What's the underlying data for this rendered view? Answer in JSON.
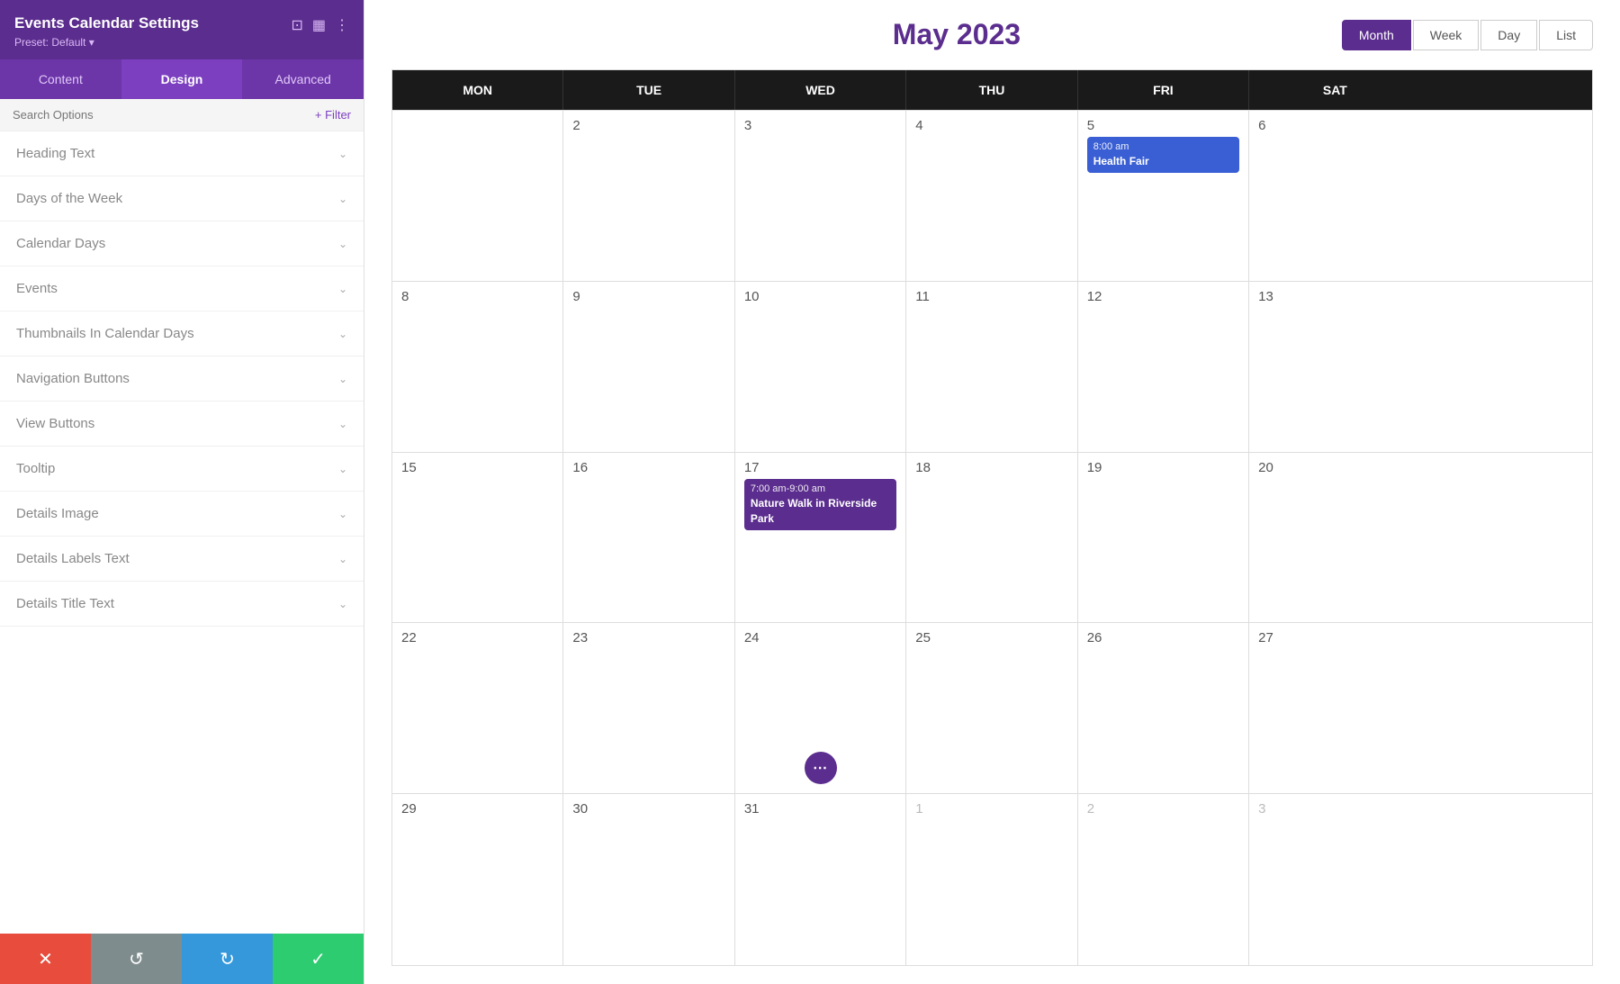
{
  "sidebar": {
    "title": "Events Calendar Settings",
    "preset": "Preset: Default ▾",
    "icons": {
      "minimize": "⊡",
      "layout": "▦",
      "more": "⋮"
    },
    "tabs": [
      {
        "id": "content",
        "label": "Content",
        "active": false
      },
      {
        "id": "design",
        "label": "Design",
        "active": true
      },
      {
        "id": "advanced",
        "label": "Advanced",
        "active": false
      }
    ],
    "search": {
      "placeholder": "Search Options",
      "filter_label": "+ Filter"
    },
    "items": [
      {
        "id": "heading-text",
        "label": "Heading Text"
      },
      {
        "id": "days-of-week",
        "label": "Days of the Week"
      },
      {
        "id": "calendar-days",
        "label": "Calendar Days"
      },
      {
        "id": "events",
        "label": "Events"
      },
      {
        "id": "thumbnails",
        "label": "Thumbnails In Calendar Days"
      },
      {
        "id": "navigation-buttons",
        "label": "Navigation Buttons"
      },
      {
        "id": "view-buttons",
        "label": "View Buttons"
      },
      {
        "id": "tooltip",
        "label": "Tooltip"
      },
      {
        "id": "details-image",
        "label": "Details Image"
      },
      {
        "id": "details-labels-text",
        "label": "Details Labels Text"
      },
      {
        "id": "details-title-text",
        "label": "Details Title Text"
      }
    ],
    "toolbar": {
      "cancel": "✕",
      "undo": "↺",
      "redo": "↻",
      "save": "✓"
    }
  },
  "calendar": {
    "title": "May 2023",
    "view_buttons": [
      {
        "id": "month",
        "label": "Month",
        "active": true
      },
      {
        "id": "week",
        "label": "Week",
        "active": false
      },
      {
        "id": "day",
        "label": "Day",
        "active": false
      },
      {
        "id": "list",
        "label": "List",
        "active": false
      }
    ],
    "day_headers": [
      "MON",
      "TUE",
      "WED",
      "THU",
      "FRI",
      "SAT"
    ],
    "rows": [
      {
        "cells": [
          {
            "date": "",
            "muted": false,
            "events": []
          },
          {
            "date": "2",
            "muted": false,
            "events": []
          },
          {
            "date": "3",
            "muted": false,
            "events": []
          },
          {
            "date": "4",
            "muted": false,
            "events": []
          },
          {
            "date": "5",
            "muted": false,
            "events": [
              {
                "time": "8:00 am",
                "title": "Health Fair",
                "color": "blue"
              }
            ]
          },
          {
            "date": "6",
            "muted": false,
            "events": []
          }
        ]
      },
      {
        "cells": [
          {
            "date": "8",
            "muted": false,
            "events": []
          },
          {
            "date": "9",
            "muted": false,
            "events": []
          },
          {
            "date": "10",
            "muted": false,
            "events": []
          },
          {
            "date": "11",
            "muted": false,
            "events": []
          },
          {
            "date": "12",
            "muted": false,
            "events": []
          },
          {
            "date": "13",
            "muted": false,
            "events": []
          }
        ]
      },
      {
        "cells": [
          {
            "date": "15",
            "muted": false,
            "events": []
          },
          {
            "date": "16",
            "muted": false,
            "events": []
          },
          {
            "date": "17",
            "muted": false,
            "events": [
              {
                "time": "7:00 am-9:00 am",
                "title": "Nature Walk in Riverside Park",
                "color": "purple"
              }
            ]
          },
          {
            "date": "18",
            "muted": false,
            "events": []
          },
          {
            "date": "19",
            "muted": false,
            "events": []
          },
          {
            "date": "20",
            "muted": false,
            "events": []
          }
        ]
      },
      {
        "cells": [
          {
            "date": "22",
            "muted": false,
            "events": []
          },
          {
            "date": "23",
            "muted": false,
            "events": []
          },
          {
            "date": "24",
            "muted": false,
            "events": [],
            "has_more": true
          },
          {
            "date": "25",
            "muted": false,
            "events": []
          },
          {
            "date": "26",
            "muted": false,
            "events": []
          },
          {
            "date": "27",
            "muted": false,
            "events": []
          }
        ]
      },
      {
        "cells": [
          {
            "date": "29",
            "muted": false,
            "events": []
          },
          {
            "date": "30",
            "muted": false,
            "events": []
          },
          {
            "date": "31",
            "muted": false,
            "events": []
          },
          {
            "date": "1",
            "muted": true,
            "events": []
          },
          {
            "date": "2",
            "muted": true,
            "events": []
          },
          {
            "date": "3",
            "muted": true,
            "events": []
          }
        ]
      }
    ]
  },
  "colors": {
    "brand_purple": "#5b2d8e",
    "header_bg": "#1a1a1a",
    "event_blue": "#3a5fd4",
    "event_purple": "#5b2d8e",
    "active_view": "#5b2d8e"
  }
}
